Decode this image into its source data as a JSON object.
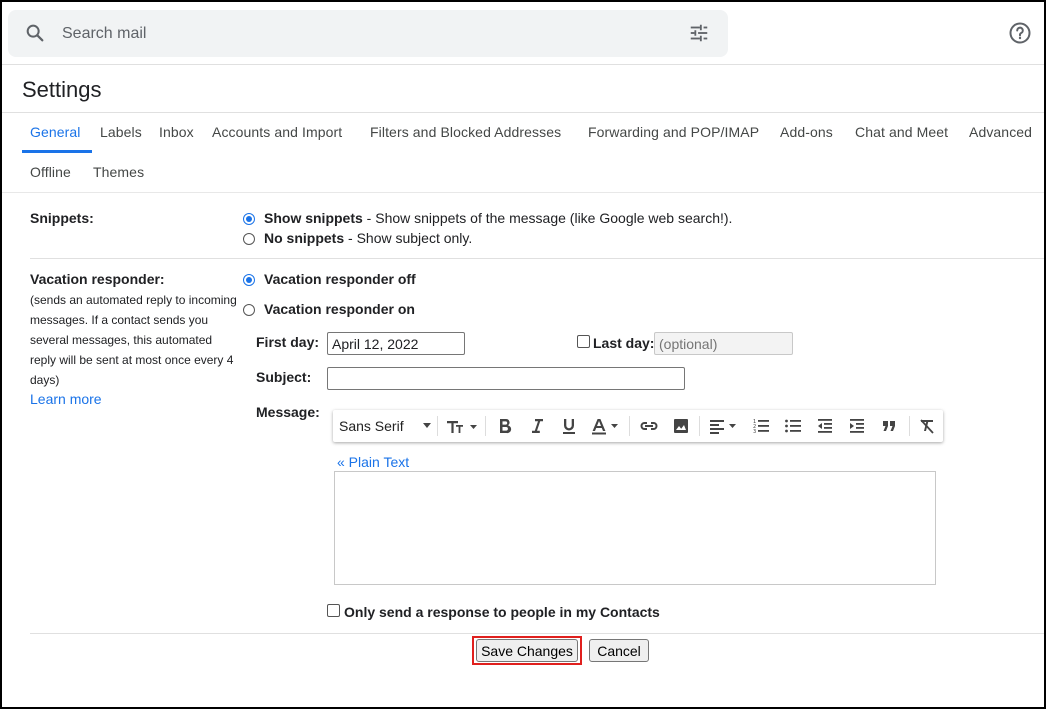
{
  "search": {
    "placeholder": "Search mail"
  },
  "page": {
    "title": "Settings"
  },
  "tabs": [
    {
      "label": "General",
      "active": true
    },
    {
      "label": "Labels"
    },
    {
      "label": "Inbox"
    },
    {
      "label": "Accounts and Import"
    },
    {
      "label": "Filters and Blocked Addresses"
    },
    {
      "label": "Forwarding and POP/IMAP"
    },
    {
      "label": "Add-ons"
    },
    {
      "label": "Chat and Meet"
    },
    {
      "label": "Advanced"
    },
    {
      "label": "Offline"
    },
    {
      "label": "Themes"
    }
  ],
  "snippets": {
    "label": "Snippets:",
    "show_label": "Show snippets",
    "show_desc": " - Show snippets of the message (like Google web search!).",
    "no_label": "No snippets",
    "no_desc": " - Show subject only.",
    "selected": "show"
  },
  "vacation": {
    "label": "Vacation responder:",
    "description": "(sends an automated reply to incoming messages. If a contact sends you several messages, this automated reply will be sent at most once every 4 days)",
    "learn_more": "Learn more",
    "off_label": "Vacation responder off",
    "on_label": "Vacation responder on",
    "selected": "off",
    "first_day_label": "First day:",
    "first_day_value": "April 12, 2022",
    "last_day_label": "Last day:",
    "last_day_placeholder": "(optional)",
    "last_day_checked": false,
    "subject_label": "Subject:",
    "subject_value": "",
    "message_label": "Message:",
    "font_name": "Sans Serif",
    "plain_text_link": "« Plain Text",
    "message_value": "",
    "contacts_only_label": "Only send a response to people in my Contacts",
    "contacts_only_checked": false
  },
  "actions": {
    "save": "Save Changes",
    "cancel": "Cancel"
  },
  "colors": {
    "accent": "#1a73e8",
    "highlight": "#e0201e"
  }
}
